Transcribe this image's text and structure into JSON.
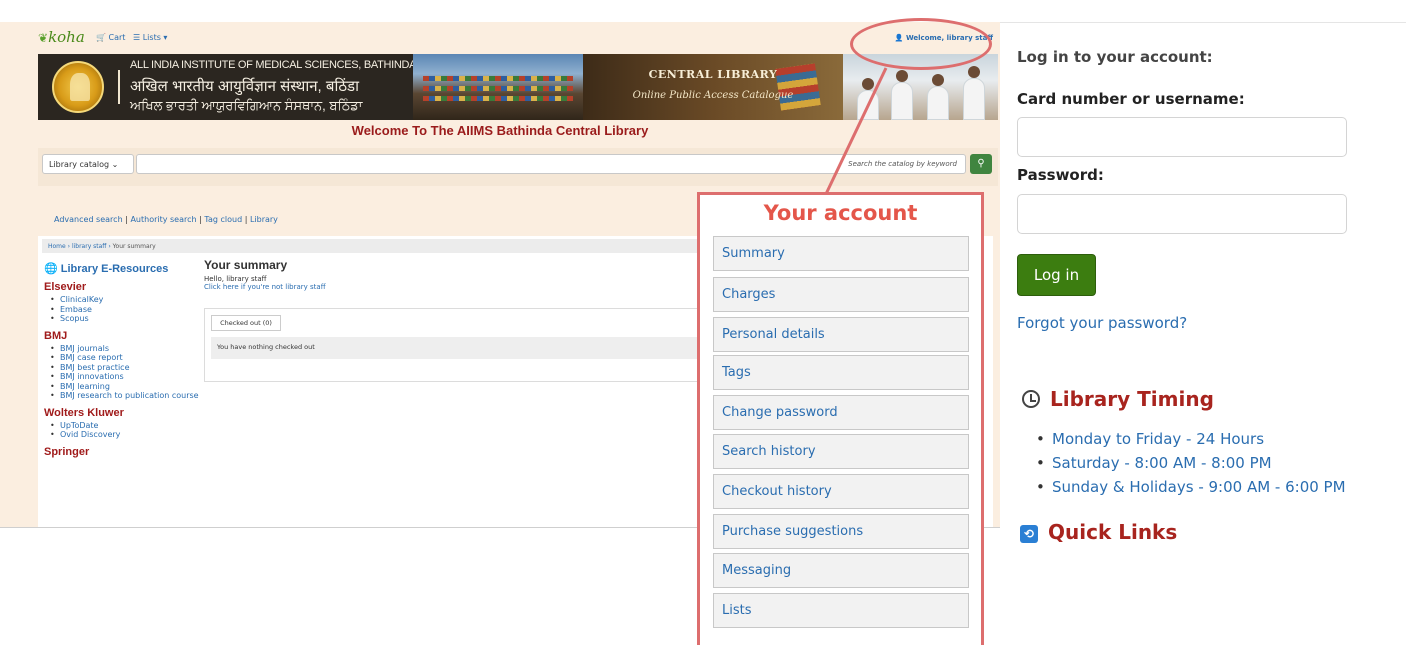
{
  "opac": {
    "logo": "koha",
    "cart_label": "Cart",
    "lists_label": "Lists",
    "welcome": "Welcome, library staff",
    "banner": {
      "line1": "ALL INDIA INSTITUTE OF MEDICAL SCIENCES, BATHINDA",
      "line2": "अखिल भारतीय आयुर्विज्ञान संस्थान, बठिंडा",
      "line3": "ਅਖਿਲ ਭਾਰਤੀ ਆਯੁਰਵਿਗਿਆਨ ਸੰਸਥਾਨ, ਬਠਿੰਡਾ",
      "central_library": "CENTRAL LIBRARY",
      "catalog_sub": "Online Public Access Catalogue"
    },
    "site_title": "Welcome To The AIIMS Bathinda Central Library",
    "search": {
      "scope": "Library catalog",
      "placeholder": "Search the catalog by keyword"
    },
    "more_searches": [
      "Advanced search",
      "Authority search",
      "Tag cloud",
      "Library"
    ],
    "breadcrumb": [
      "Home",
      "library staff",
      "Your summary"
    ],
    "sidebar": {
      "heading": "Library E-Resources",
      "groups": [
        {
          "name": "Elsevier",
          "items": [
            "ClinicalKey",
            "Embase",
            "Scopus"
          ]
        },
        {
          "name": "BMJ",
          "items": [
            "BMJ journals",
            "BMJ case report",
            "BMJ best practice",
            "BMJ innovations",
            "BMJ learning",
            "BMJ research to publication course"
          ]
        },
        {
          "name": "Wolters Kluwer",
          "items": [
            "UpToDate",
            "Ovid Discovery"
          ]
        },
        {
          "name": "Springer",
          "items": []
        }
      ]
    },
    "summary": {
      "title": "Your summary",
      "hello": "Hello, library staff",
      "not_user": "Click here if you're not library staff",
      "tab": "Checked out (0)",
      "empty": "You have nothing checked out"
    }
  },
  "account": {
    "title": "Your account",
    "items": [
      "Summary",
      "Charges",
      "Personal details",
      "Tags",
      "Change password",
      "Search history",
      "Checkout history",
      "Purchase suggestions",
      "Messaging",
      "Lists"
    ]
  },
  "login": {
    "title": "Log in to your account:",
    "card_label": "Card number or username:",
    "password_label": "Password:",
    "button": "Log in",
    "forgot": "Forgot your password?",
    "timing_title": "Library Timing",
    "timings": [
      "Monday to Friday - 24 Hours",
      "Saturday - 8:00 AM - 8:00 PM",
      "Sunday & Holidays - 9:00 AM - 6:00 PM"
    ],
    "quick_links": "Quick Links"
  },
  "colors": {
    "accent_red": "#dd6e6e",
    "link_blue": "#2a6db0",
    "login_green": "#3c7d10",
    "heading_red": "#a8241e"
  }
}
